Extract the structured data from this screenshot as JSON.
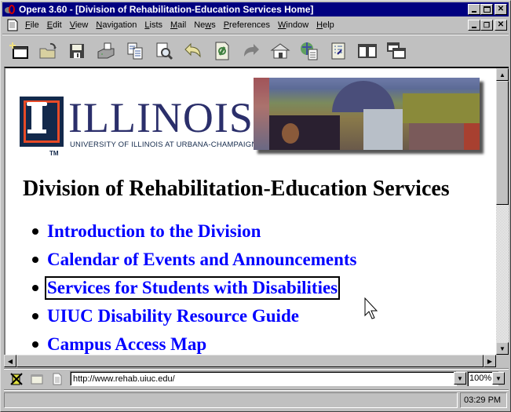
{
  "window": {
    "title": "Opera 3.60 - [Division of Rehabilitation-Education Services Home]",
    "title_bar_color": "#000080"
  },
  "menubar": {
    "items": [
      {
        "label": "File",
        "accel": "F"
      },
      {
        "label": "Edit",
        "accel": "E"
      },
      {
        "label": "View",
        "accel": "V"
      },
      {
        "label": "Navigation",
        "accel": "N"
      },
      {
        "label": "Lists",
        "accel": "L"
      },
      {
        "label": "Mail",
        "accel": "M"
      },
      {
        "label": "News",
        "accel": "w"
      },
      {
        "label": "Preferences",
        "accel": "P"
      },
      {
        "label": "Window",
        "accel": "W"
      },
      {
        "label": "Help",
        "accel": "H"
      }
    ]
  },
  "toolbar": {
    "buttons": [
      {
        "name": "new-window",
        "icon": "new-window-icon"
      },
      {
        "name": "open",
        "icon": "open-folder-icon"
      },
      {
        "name": "save",
        "icon": "floppy-disk-icon"
      },
      {
        "name": "print",
        "icon": "printer-icon"
      },
      {
        "name": "copy",
        "icon": "copy-icon"
      },
      {
        "name": "find",
        "icon": "find-magnifier-icon"
      },
      {
        "name": "back",
        "icon": "back-arrow-icon"
      },
      {
        "name": "reload",
        "icon": "reload-icon"
      },
      {
        "name": "forward",
        "icon": "forward-arrow-icon"
      },
      {
        "name": "home",
        "icon": "home-icon"
      },
      {
        "name": "hotlist",
        "icon": "globe-document-icon"
      },
      {
        "name": "history",
        "icon": "history-icon"
      },
      {
        "name": "tile",
        "icon": "tile-windows-icon"
      },
      {
        "name": "cascade",
        "icon": "cascade-windows-icon"
      }
    ]
  },
  "page": {
    "logo_word": "ILLINOIS",
    "logo_sub": "UNIVERSITY OF ILLINOIS AT URBANA-CHAMPAIGN",
    "logo_tm": "TM",
    "heading": "Division of Rehabilitation-Education Services",
    "links": [
      {
        "label": "Introduction to the Division",
        "focused": false
      },
      {
        "label": "Calendar of Events and Announcements",
        "focused": false
      },
      {
        "label": "Services for Students with Disabilities",
        "focused": true
      },
      {
        "label": "UIUC Disability Resource Guide",
        "focused": false
      },
      {
        "label": "Campus Access Map",
        "focused": false
      }
    ],
    "link_color": "#0000ff",
    "brand_colors": {
      "navy": "#13294b",
      "orange": "#e84a27"
    }
  },
  "address_bar": {
    "url": "http://www.rehab.uiuc.edu/",
    "zoom": "100%"
  },
  "status_bar": {
    "message": "",
    "clock": "03:29 PM"
  }
}
